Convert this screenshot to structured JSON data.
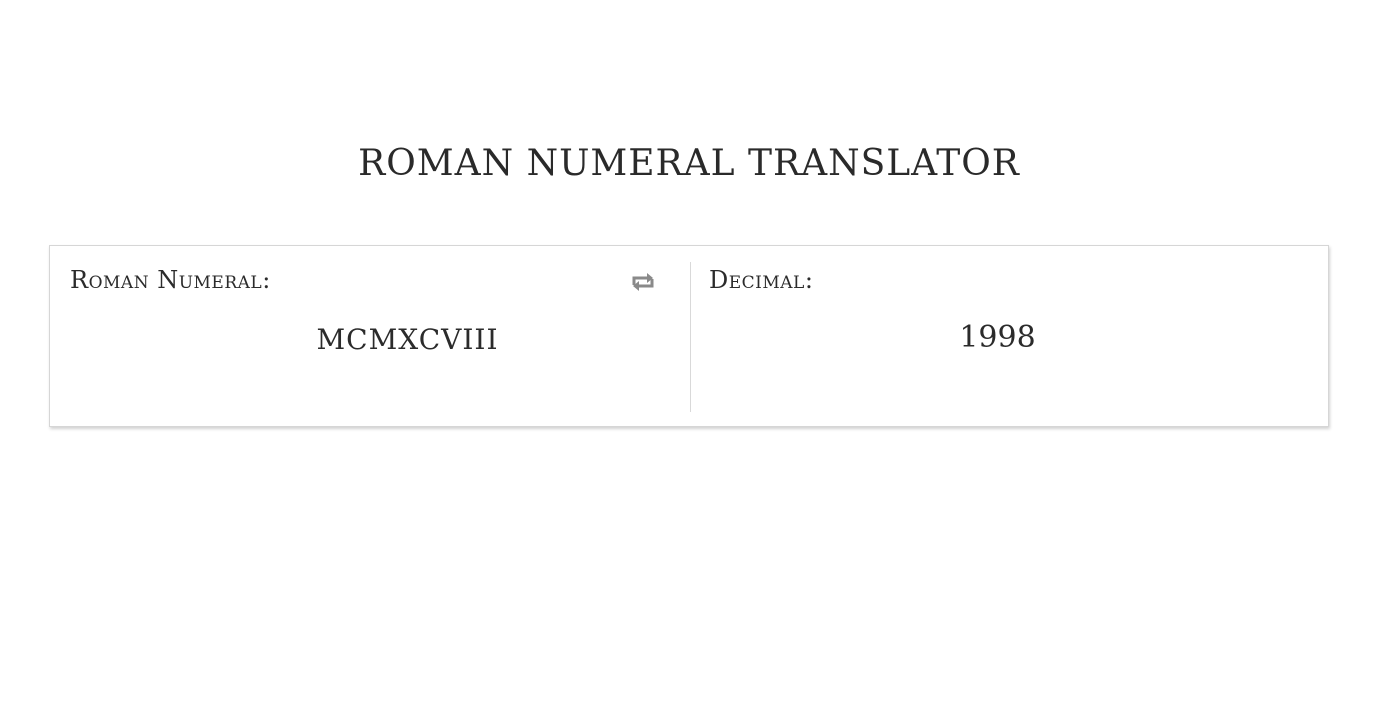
{
  "header": {
    "title": "ROMAN NUMERAL TRANSLATOR"
  },
  "translator": {
    "roman": {
      "label": "Roman Numeral:",
      "value": "MCMXCVIII"
    },
    "decimal": {
      "label": "Decimal:",
      "value": "1998"
    },
    "swap_icon": "swap-arrows-icon"
  },
  "colors": {
    "text": "#2b2b2b",
    "icon": "#8a8a8a",
    "border": "#d6d6d6"
  }
}
